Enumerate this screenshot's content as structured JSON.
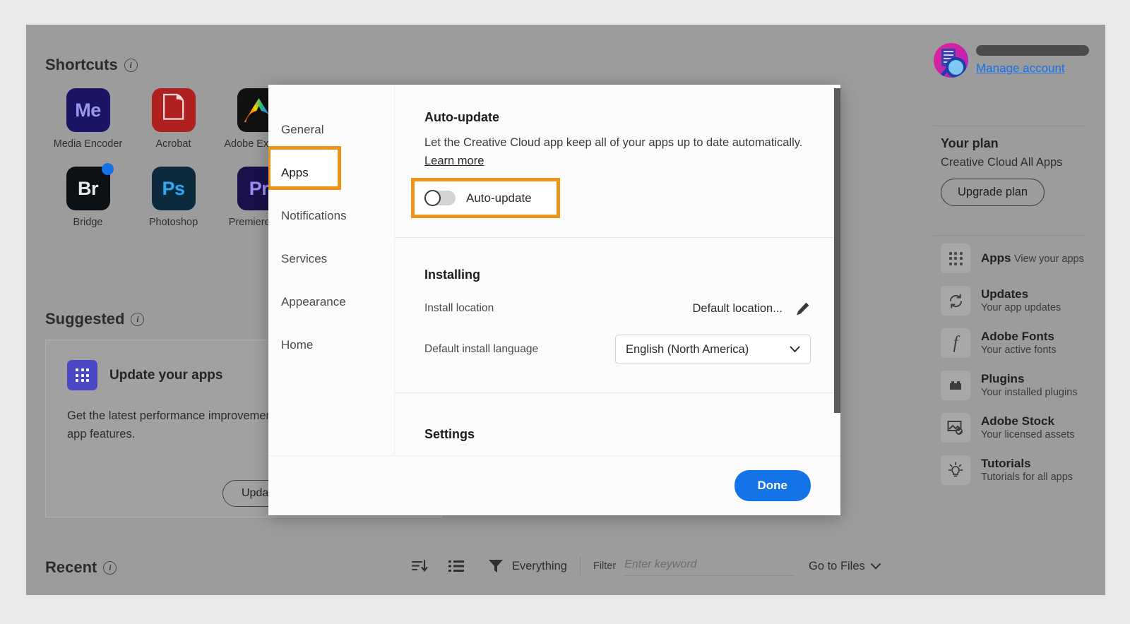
{
  "app": {
    "shortcuts": {
      "heading": "Shortcuts",
      "info_icon": "info-icon",
      "items": [
        {
          "name": "Media Encoder",
          "abbr": "Me",
          "bg": "#1b1464",
          "fg": "#9a97f0",
          "badge": false
        },
        {
          "name": "Acrobat",
          "abbr": "A",
          "bg": "#b0201e",
          "fg": "#f3d9d9",
          "badge": false
        },
        {
          "name": "Adobe Express",
          "abbr": "Ax",
          "bg": "#111111",
          "fg": "#ffffff",
          "badge": false
        },
        {
          "name": "Bridge",
          "abbr": "Br",
          "bg": "#0c1116",
          "fg": "#e8e8e8",
          "badge": true
        },
        {
          "name": "Photoshop",
          "abbr": "Ps",
          "bg": "#0c2a3d",
          "fg": "#2fa8f7",
          "badge": false
        },
        {
          "name": "Premiere Pro",
          "abbr": "Pr",
          "bg": "#19124a",
          "fg": "#a38cf5",
          "badge": false
        }
      ]
    },
    "suggested": {
      "heading": "Suggested",
      "card": {
        "title": "Update your apps",
        "icon": "apps-grid-icon",
        "description": "Get the latest performance improvements, bug fixes, and app features.",
        "button": "Update now"
      }
    },
    "recent": {
      "heading": "Recent"
    },
    "toolbar": {
      "sort_icon": "sort-descending-icon",
      "view_icon": "list-view-icon",
      "filter_icon": "funnel-icon",
      "filter_scope": "Everything",
      "filter_label": "Filter",
      "filter_placeholder": "Enter keyword",
      "filter_value": "",
      "go_to_files": "Go to Files",
      "go_to_files_icon": "chevron-down-icon"
    }
  },
  "rail": {
    "account": {
      "avatar_icon": "user-avatar-image",
      "name_redacted": "",
      "manage_account": "Manage account"
    },
    "plan": {
      "title": "Your plan",
      "name": "Creative Cloud All Apps",
      "upgrade_button": "Upgrade plan"
    },
    "nav": [
      {
        "title": "Apps",
        "sub": "View your apps",
        "icon": "apps-grid-icon"
      },
      {
        "title": "Updates",
        "sub": "Your app updates",
        "icon": "refresh-icon"
      },
      {
        "title": "Adobe Fonts",
        "sub": "Your active fonts",
        "icon": "font-f-icon"
      },
      {
        "title": "Plugins",
        "sub": "Your installed plugins",
        "icon": "plugin-brick-icon"
      },
      {
        "title": "Adobe Stock",
        "sub": "Your licensed assets",
        "icon": "stock-image-check-icon"
      },
      {
        "title": "Tutorials",
        "sub": "Tutorials for all apps",
        "icon": "lightbulb-icon"
      }
    ]
  },
  "modal": {
    "nav": [
      {
        "label": "General",
        "active": false
      },
      {
        "label": "Apps",
        "active": true
      },
      {
        "label": "Notifications",
        "active": false
      },
      {
        "label": "Services",
        "active": false
      },
      {
        "label": "Appearance",
        "active": false
      },
      {
        "label": "Home",
        "active": false
      }
    ],
    "auto_update": {
      "title": "Auto-update",
      "description": "Let the Creative Cloud app keep all of your apps up to date automatically.",
      "learn_more": "Learn more",
      "toggle_label": "Auto-update",
      "toggle_state": "off"
    },
    "installing": {
      "title": "Installing",
      "install_location_label": "Install location",
      "install_location_value": "Default location...",
      "edit_icon": "pencil-icon",
      "language_label": "Default install language",
      "language_value": "English (North America)",
      "language_chevron": "chevron-down-icon"
    },
    "settings": {
      "title": "Settings"
    },
    "footer": {
      "done_button": "Done"
    },
    "scrollbar": "vertical-scrollbar"
  },
  "colors": {
    "highlight": "#eb9417",
    "accent_blue": "#1473e6",
    "link_blue": "#1473e6"
  }
}
